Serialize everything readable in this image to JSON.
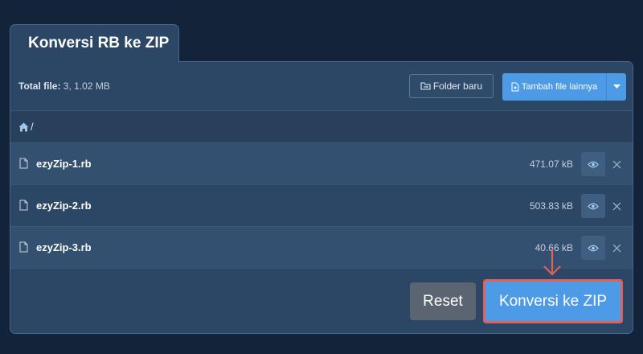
{
  "tab": {
    "title": "Konversi RB ke ZIP"
  },
  "toolbar": {
    "total_label": "Total file:",
    "total_value": "3, 1.02 MB",
    "folder_button": "Folder baru",
    "add_button": "Tambah file lainnya"
  },
  "breadcrumb": {
    "separator": "/"
  },
  "files": [
    {
      "name": "ezyZip-1.rb",
      "size": "471.07 kB"
    },
    {
      "name": "ezyZip-2.rb",
      "size": "503.83 kB"
    },
    {
      "name": "ezyZip-3.rb",
      "size": "40.66 kB"
    }
  ],
  "actions": {
    "reset_label": "Reset",
    "convert_label": "Konversi ke ZIP"
  },
  "icons": {
    "home": "home-icon",
    "file": "file-icon",
    "eye": "eye-icon",
    "close": "close-icon",
    "folder": "folder-sync-icon",
    "add_file": "file-plus-icon",
    "caret": "caret-down-icon"
  },
  "colors": {
    "background": "#13233a",
    "panel": "#2c4766",
    "primary": "#4d9be6",
    "highlight_border": "#e0605c",
    "reset": "#5b6471"
  }
}
